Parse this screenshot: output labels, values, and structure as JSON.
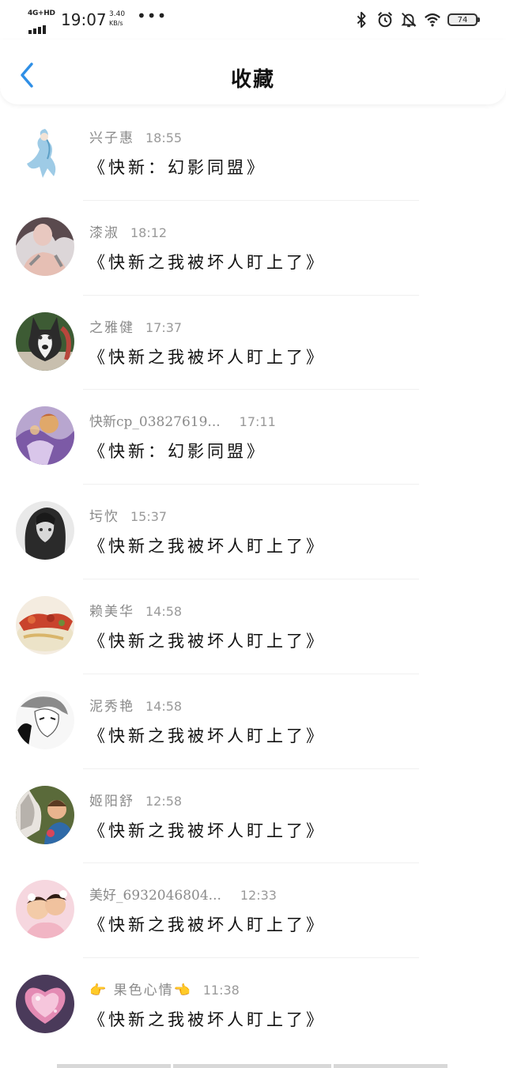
{
  "status_bar": {
    "network": "4G+HD",
    "time": "19:07",
    "speed_value": "3.40",
    "speed_unit": "KB/s",
    "more": "•••",
    "battery": "74"
  },
  "header": {
    "title": "收藏"
  },
  "items": [
    {
      "name": "兴子惠",
      "time": "18:55",
      "title": "《快新：幻影同盟》"
    },
    {
      "name": "漆淑",
      "time": "18:12",
      "title": "《快新之我被坏人盯上了》"
    },
    {
      "name": "之雅健",
      "time": "17:37",
      "title": "《快新之我被坏人盯上了》"
    },
    {
      "name": "快新cp_03827619...",
      "time": "17:11",
      "title": "《快新：幻影同盟》"
    },
    {
      "name": "圬忺",
      "time": "15:37",
      "title": "《快新之我被坏人盯上了》"
    },
    {
      "name": "赖美华",
      "time": "14:58",
      "title": "《快新之我被坏人盯上了》"
    },
    {
      "name": "泥秀艳",
      "time": "14:58",
      "title": "《快新之我被坏人盯上了》"
    },
    {
      "name": "姬阳舒",
      "time": "12:58",
      "title": "《快新之我被坏人盯上了》"
    },
    {
      "name": "美好_6932046804...",
      "time": "12:33",
      "title": "《快新之我被坏人盯上了》"
    },
    {
      "name": "👉 果色心情👈",
      "time": "11:38",
      "title": "《快新之我被坏人盯上了》"
    }
  ],
  "colors": {
    "accent": "#2f8fe6",
    "name_text": "#8a8a8a",
    "title_text": "#111111"
  }
}
